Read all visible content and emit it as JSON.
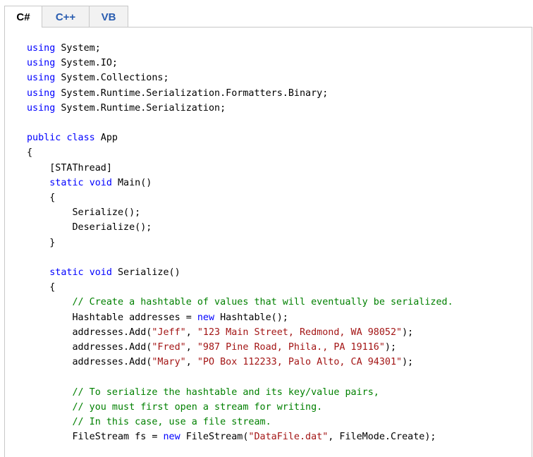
{
  "tabs": [
    {
      "label": "C#",
      "active": true
    },
    {
      "label": "C++",
      "active": false
    },
    {
      "label": "VB",
      "active": false
    }
  ],
  "colors": {
    "keyword": "#0000ff",
    "string": "#a31515",
    "comment": "#008000",
    "tab_link": "#2a5db0",
    "border": "#c8c8c8"
  },
  "code_lines": [
    [
      {
        "t": "kw",
        "s": "using"
      },
      {
        "t": "plain",
        "s": " System;"
      }
    ],
    [
      {
        "t": "kw",
        "s": "using"
      },
      {
        "t": "plain",
        "s": " System.IO;"
      }
    ],
    [
      {
        "t": "kw",
        "s": "using"
      },
      {
        "t": "plain",
        "s": " System.Collections;"
      }
    ],
    [
      {
        "t": "kw",
        "s": "using"
      },
      {
        "t": "plain",
        "s": " System.Runtime.Serialization.Formatters.Binary;"
      }
    ],
    [
      {
        "t": "kw",
        "s": "using"
      },
      {
        "t": "plain",
        "s": " System.Runtime.Serialization;"
      }
    ],
    [],
    [
      {
        "t": "kw",
        "s": "public"
      },
      {
        "t": "plain",
        "s": " "
      },
      {
        "t": "kw",
        "s": "class"
      },
      {
        "t": "plain",
        "s": " App"
      }
    ],
    [
      {
        "t": "plain",
        "s": "{"
      }
    ],
    [
      {
        "t": "plain",
        "s": "    [STAThread]"
      }
    ],
    [
      {
        "t": "plain",
        "s": "    "
      },
      {
        "t": "kw",
        "s": "static"
      },
      {
        "t": "plain",
        "s": " "
      },
      {
        "t": "kw",
        "s": "void"
      },
      {
        "t": "plain",
        "s": " Main()"
      }
    ],
    [
      {
        "t": "plain",
        "s": "    {"
      }
    ],
    [
      {
        "t": "plain",
        "s": "        Serialize();"
      }
    ],
    [
      {
        "t": "plain",
        "s": "        Deserialize();"
      }
    ],
    [
      {
        "t": "plain",
        "s": "    }"
      }
    ],
    [],
    [
      {
        "t": "plain",
        "s": "    "
      },
      {
        "t": "kw",
        "s": "static"
      },
      {
        "t": "plain",
        "s": " "
      },
      {
        "t": "kw",
        "s": "void"
      },
      {
        "t": "plain",
        "s": " Serialize()"
      }
    ],
    [
      {
        "t": "plain",
        "s": "    {"
      }
    ],
    [
      {
        "t": "plain",
        "s": "        "
      },
      {
        "t": "cm",
        "s": "// Create a hashtable of values that will eventually be serialized."
      }
    ],
    [
      {
        "t": "plain",
        "s": "        Hashtable addresses = "
      },
      {
        "t": "kw",
        "s": "new"
      },
      {
        "t": "plain",
        "s": " Hashtable();"
      }
    ],
    [
      {
        "t": "plain",
        "s": "        addresses.Add("
      },
      {
        "t": "str",
        "s": "\"Jeff\""
      },
      {
        "t": "plain",
        "s": ", "
      },
      {
        "t": "str",
        "s": "\"123 Main Street, Redmond, WA 98052\""
      },
      {
        "t": "plain",
        "s": ");"
      }
    ],
    [
      {
        "t": "plain",
        "s": "        addresses.Add("
      },
      {
        "t": "str",
        "s": "\"Fred\""
      },
      {
        "t": "plain",
        "s": ", "
      },
      {
        "t": "str",
        "s": "\"987 Pine Road, Phila., PA 19116\""
      },
      {
        "t": "plain",
        "s": ");"
      }
    ],
    [
      {
        "t": "plain",
        "s": "        addresses.Add("
      },
      {
        "t": "str",
        "s": "\"Mary\""
      },
      {
        "t": "plain",
        "s": ", "
      },
      {
        "t": "str",
        "s": "\"PO Box 112233, Palo Alto, CA 94301\""
      },
      {
        "t": "plain",
        "s": ");"
      }
    ],
    [],
    [
      {
        "t": "plain",
        "s": "        "
      },
      {
        "t": "cm",
        "s": "// To serialize the hashtable and its key/value pairs,"
      }
    ],
    [
      {
        "t": "plain",
        "s": "        "
      },
      {
        "t": "cm",
        "s": "// you must first open a stream for writing."
      }
    ],
    [
      {
        "t": "plain",
        "s": "        "
      },
      {
        "t": "cm",
        "s": "// In this case, use a file stream."
      }
    ],
    [
      {
        "t": "plain",
        "s": "        FileStream fs = "
      },
      {
        "t": "kw",
        "s": "new"
      },
      {
        "t": "plain",
        "s": " FileStream("
      },
      {
        "t": "str",
        "s": "\"DataFile.dat\""
      },
      {
        "t": "plain",
        "s": ", FileMode.Create);"
      }
    ]
  ]
}
